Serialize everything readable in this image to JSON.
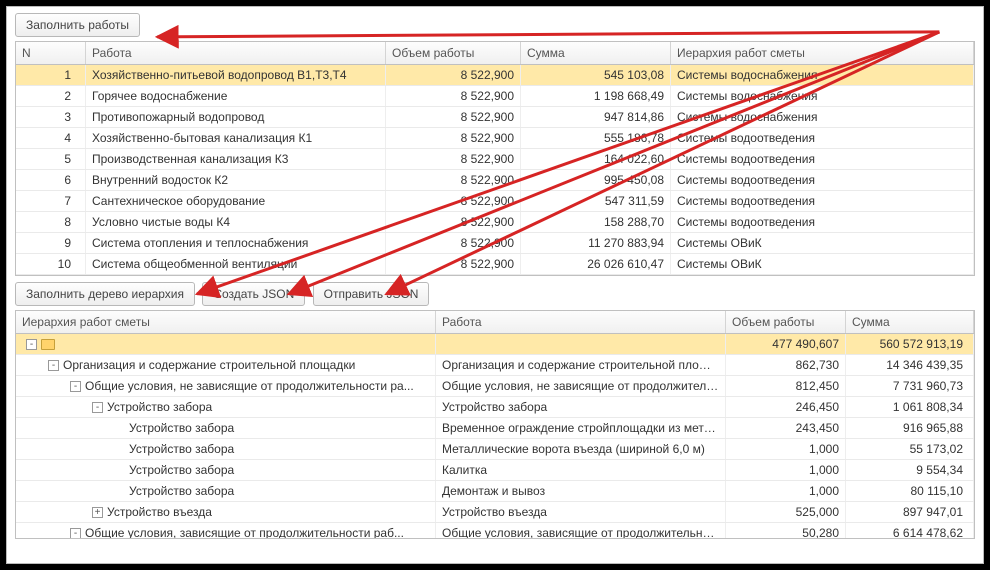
{
  "buttons": {
    "fill_works": "Заполнить работы",
    "fill_tree": "Заполнить дерево иерархия",
    "create_json": "Создать JSON",
    "send_json": "Отправить JSON"
  },
  "top_grid": {
    "headers": {
      "n": "N",
      "work": "Работа",
      "volume": "Объем работы",
      "sum": "Сумма",
      "hierarchy": "Иерархия работ сметы"
    },
    "rows": [
      {
        "n": "1",
        "work": "Хозяйственно-питьевой водопровод  В1,Т3,Т4",
        "volume": "8 522,900",
        "sum": "545 103,08",
        "hier": "Системы водоснабжения"
      },
      {
        "n": "2",
        "work": "Горячее водоснабжение",
        "volume": "8 522,900",
        "sum": "1 198 668,49",
        "hier": "Системы водоснабжения"
      },
      {
        "n": "3",
        "work": "Противопожарный водопровод",
        "volume": "8 522,900",
        "sum": "947 814,86",
        "hier": "Системы водоснабжения"
      },
      {
        "n": "4",
        "work": "Хозяйственно-бытовая канализация К1",
        "volume": "8 522,900",
        "sum": "555 186,78",
        "hier": "Системы водоотведения"
      },
      {
        "n": "5",
        "work": "Производственная канализация К3",
        "volume": "8 522,900",
        "sum": "164 022,60",
        "hier": "Системы водоотведения"
      },
      {
        "n": "6",
        "work": "Внутренний водосток К2",
        "volume": "8 522,900",
        "sum": "995 450,08",
        "hier": "Системы водоотведения"
      },
      {
        "n": "7",
        "work": "Сантехническое оборудование",
        "volume": "8 522,900",
        "sum": "547 311,59",
        "hier": "Системы водоотведения"
      },
      {
        "n": "8",
        "work": "Условно чистые воды К4",
        "volume": "8 522,900",
        "sum": "158 288,70",
        "hier": "Системы водоотведения"
      },
      {
        "n": "9",
        "work": "Система отопления и теплоснабжения",
        "volume": "8 522,900",
        "sum": "11 270 883,94",
        "hier": "Системы ОВиК"
      },
      {
        "n": "10",
        "work": "Система общеобменной вентиляции",
        "volume": "8 522,900",
        "sum": "26 026 610,47",
        "hier": "Системы ОВиК"
      }
    ]
  },
  "bottom_grid": {
    "headers": {
      "hier": "Иерархия работ сметы",
      "work": "Работа",
      "volume": "Объем работы",
      "sum": "Сумма"
    },
    "rows": [
      {
        "depth": 0,
        "toggle": "-",
        "folder": true,
        "hier": "",
        "work": "",
        "volume": "477 490,607",
        "sum": "560 572 913,19",
        "selected": true
      },
      {
        "depth": 1,
        "toggle": "-",
        "hier": "Организация и содержание строительной площадки",
        "work": "Организация и содержание строительной площа...",
        "volume": "862,730",
        "sum": "14 346 439,35"
      },
      {
        "depth": 2,
        "toggle": "-",
        "hier": "Общие условия, не зависящие от продолжительности ра...",
        "work": "Общие условия, не зависящие от продолжитель...",
        "volume": "812,450",
        "sum": "7 731 960,73"
      },
      {
        "depth": 3,
        "toggle": "-",
        "hier": "Устройство забора",
        "work": "Устройство забора",
        "volume": "246,450",
        "sum": "1 061 808,34"
      },
      {
        "depth": 4,
        "hier": "Устройство забора",
        "work": "Временное ограждение стройплощадки из мета...",
        "volume": "243,450",
        "sum": "916 965,88"
      },
      {
        "depth": 4,
        "hier": "Устройство забора",
        "work": "Металлические ворота въезда (шириной 6,0 м)",
        "volume": "1,000",
        "sum": "55 173,02"
      },
      {
        "depth": 4,
        "hier": "Устройство забора",
        "work": "Калитка",
        "volume": "1,000",
        "sum": "9 554,34"
      },
      {
        "depth": 4,
        "hier": "Устройство забора",
        "work": "Демонтаж и вывоз",
        "volume": "1,000",
        "sum": "80 115,10"
      },
      {
        "depth": 3,
        "toggle": "+",
        "hier": "Устройство въезда",
        "work": "Устройство въезда",
        "volume": "525,000",
        "sum": "897 947,01"
      },
      {
        "depth": 2,
        "toggle": "-",
        "hier": "Общие условия, зависящие от продолжительности раб...",
        "work": "Общие условия, зависящие от продолжительно...",
        "volume": "50,280",
        "sum": "6 614 478,62"
      }
    ]
  }
}
